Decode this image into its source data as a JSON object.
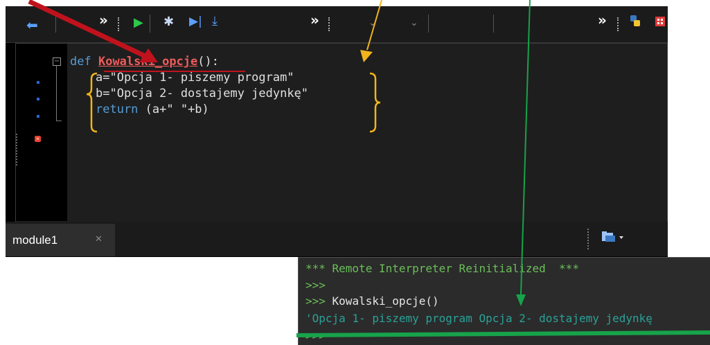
{
  "editor": {
    "code": {
      "def_keyword": "def",
      "func_name": "Kowalski_opcje",
      "def_tail": "():",
      "line2": "a=\"Opcja 1- piszemy program\"",
      "line3": "b=\"Opcja 2- dostajemy jedynkę\"",
      "line4_kw": "return",
      "line4_rest": " (a+\" \"+b)"
    },
    "tab": {
      "label": "module1"
    }
  },
  "toolbar": {
    "overflow1": "»",
    "overflow2": "»",
    "overflow3": "»"
  },
  "console": {
    "line1": "*** Remote Interpreter Reinitialized  ***",
    "line2": ">>>",
    "line3_prompt": ">>>",
    "line3_cmd": " Kowalski_opcje()",
    "line4": "'Opcja 1- piszemy program Opcja 2- dostajemy jedynkę",
    "line5": ">>>"
  },
  "colors": {
    "annotation_red": "#c0121c",
    "annotation_orange": "#f0b41c",
    "annotation_green": "#17a34a",
    "console_green": "#6bbf5a",
    "console_teal": "#2aa198"
  }
}
